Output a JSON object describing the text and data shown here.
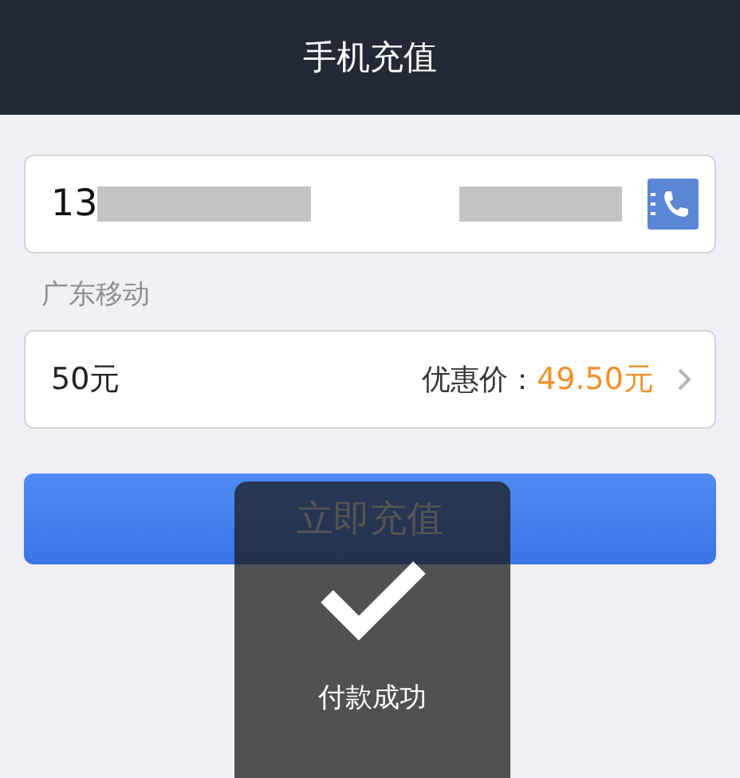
{
  "nav_bar": {
    "title": "手机充值"
  },
  "phone_field": {
    "value": "13"
  },
  "carrier": "广东移动",
  "amount_row": {
    "amount": "50元",
    "discount_label": "优惠价：",
    "discount_price": "49.50元"
  },
  "recharge_button": {
    "label": "立即充值"
  },
  "toast": {
    "message": "付款成功"
  }
}
